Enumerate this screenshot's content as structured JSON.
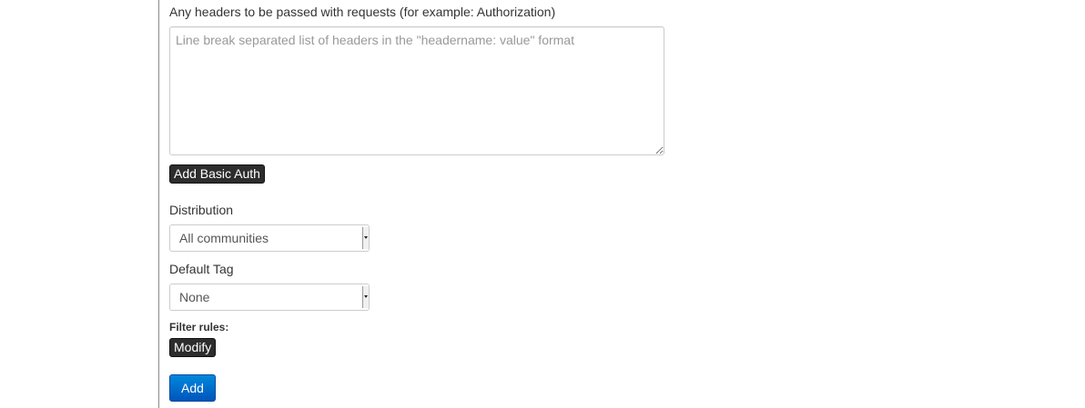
{
  "headers": {
    "label": "Any headers to be passed with requests (for example: Authorization)",
    "placeholder": "Line break separated list of headers in the \"headername: value\" format",
    "value": ""
  },
  "basic_auth": {
    "label": "Add Basic Auth"
  },
  "distribution": {
    "label": "Distribution",
    "selected": "All communities"
  },
  "default_tag": {
    "label": "Default Tag",
    "selected": "None"
  },
  "filter_rules": {
    "label": "Filter rules:",
    "modify_label": "Modify"
  },
  "submit": {
    "label": "Add"
  },
  "colors": {
    "primary_button": "#0066cc",
    "dark_button": "#2d2d2d"
  }
}
